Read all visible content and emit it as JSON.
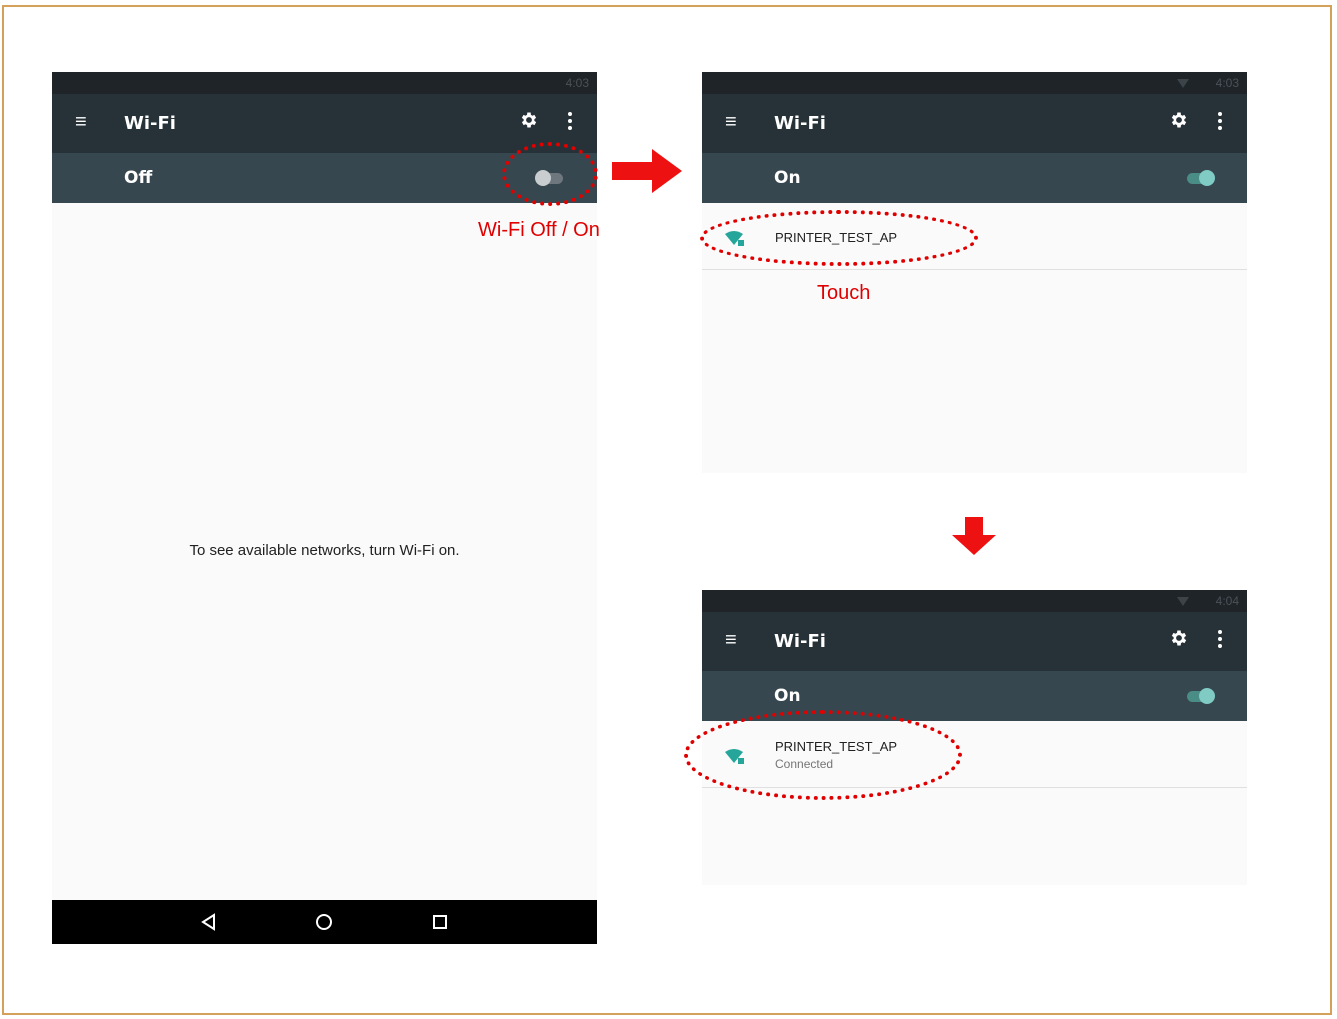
{
  "screens": {
    "off": {
      "status_time": "4:03",
      "title": "Wi-Fi",
      "switch_label": "Off",
      "empty_message": "To see available networks, turn Wi-Fi on."
    },
    "on": {
      "status_time": "4:03",
      "title": "Wi-Fi",
      "switch_label": "On",
      "network_ssid": "PRINTER_TEST_AP"
    },
    "connected": {
      "status_time": "4:04",
      "title": "Wi-Fi",
      "switch_label": "On",
      "network_ssid": "PRINTER_TEST_AP",
      "network_status": "Connected"
    }
  },
  "annotations": {
    "toggle_note": "Wi-Fi Off / On",
    "touch_note": "Touch"
  },
  "colors": {
    "accent": "#80cbc4",
    "toolbar": "#263238",
    "switchbar": "#37474f",
    "annotation": "#e00000",
    "frame": "#d4a15a"
  },
  "icons": [
    "menu-icon",
    "gear-icon",
    "more-vert-icon",
    "wifi-lock-icon",
    "back-icon",
    "home-icon",
    "recents-icon",
    "arrow-right-icon",
    "arrow-down-icon"
  ]
}
